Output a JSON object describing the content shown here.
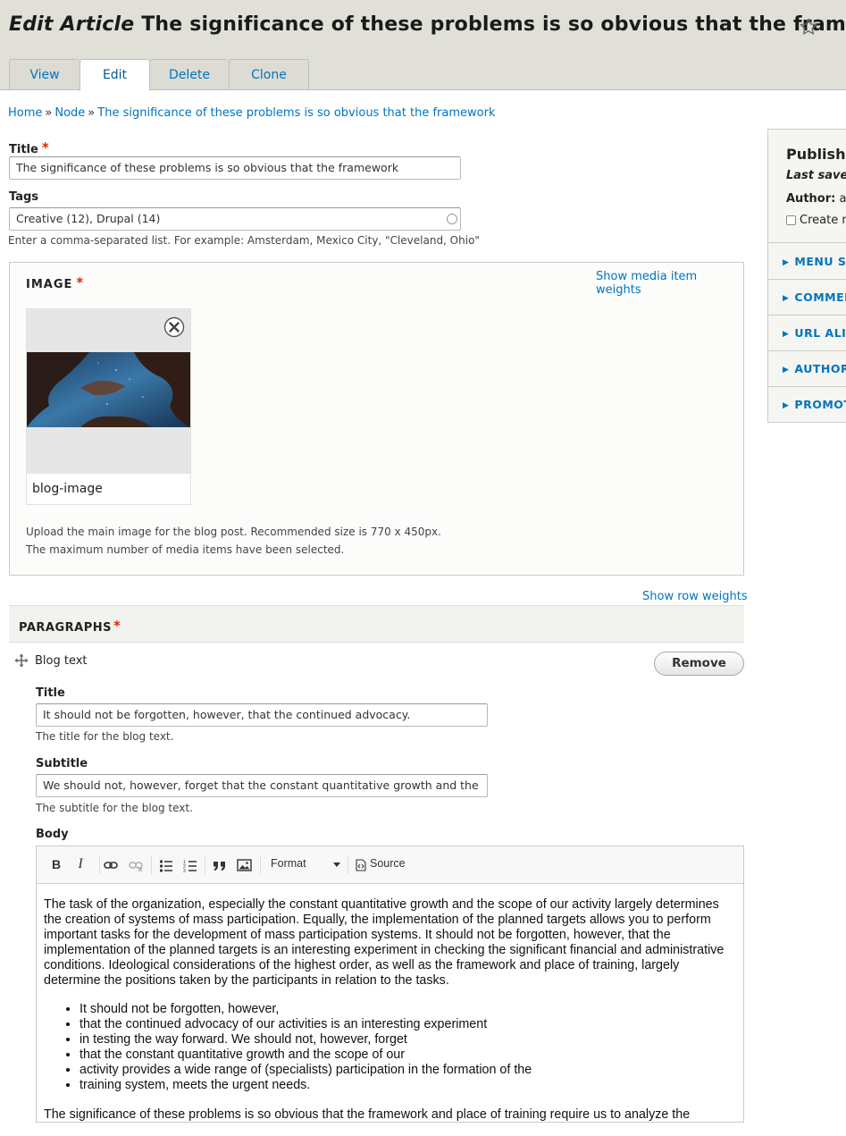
{
  "header": {
    "title_prefix": "Edit Article",
    "title": "The significance of these problems is so obvious that the framework",
    "tabs": [
      "View",
      "Edit",
      "Delete",
      "Clone"
    ]
  },
  "breadcrumb": {
    "items": [
      "Home",
      "Node",
      "The significance of these problems is so obvious that the framework"
    ],
    "separator": "»"
  },
  "form": {
    "title_label": "Title",
    "title_value": "The significance of these problems is so obvious that the framework",
    "tags_label": "Tags",
    "tags_value": "Creative (12), Drupal (14)",
    "tags_description": "Enter a comma-separated list. For example: Amsterdam, Mexico City, \"Cleveland, Ohio\"",
    "required_mark": "*"
  },
  "image": {
    "legend": "Image",
    "weights_link": "Show media item weights",
    "media_name": "blog-image",
    "description_1": "Upload the main image for the blog post. Recommended size is 770 x 450px.",
    "description_2": "The maximum number of media items have been selected."
  },
  "paragraphs": {
    "weights_link": "Show row weights",
    "header": "PARAGRAPHS",
    "item_type": "Blog text",
    "remove_label": "Remove",
    "title_label": "Title",
    "title_value": "It should not be forgotten, however, that the continued advocacy.",
    "title_description": "The title for the blog text.",
    "subtitle_label": "Subtitle",
    "subtitle_value": "We should not, however, forget that the constant quantitative growth and the",
    "subtitle_description": "The subtitle for the blog text.",
    "body_label": "Body"
  },
  "editor": {
    "toolbar": {
      "bold": "B",
      "italic": "I",
      "format_label": "Format",
      "source_label": "Source"
    },
    "paragraph_1": "The task of the organization, especially the constant quantitative growth and the scope of our activity largely determines the creation of systems of mass participation. Equally, the implementation of the planned targets allows you to perform important tasks for the development of mass participation systems. It should not be forgotten, however, that the implementation of the planned targets is an interesting experiment in checking the significant financial and administrative conditions. Ideological considerations of the highest order, as well as the framework and place of training, largely determine the positions taken by the participants in relation to the tasks.",
    "list": [
      "It should not be forgotten, however,",
      "that the continued advocacy of our activities is an interesting experiment",
      "in testing the way forward. We should not, however, forget",
      "that the constant quantitative growth and the scope of our",
      "activity provides a wide range of (specialists) participation in the formation of the",
      "training system, meets the urgent needs."
    ],
    "paragraph_2": "The significance of these problems is so obvious that the framework and place of training require us to analyze the"
  },
  "sidebar": {
    "status": "Published",
    "last_saved": "Last saved",
    "author_label": "Author:",
    "author_value": "ad",
    "revision_label": "Create n",
    "sections": [
      "MENU SE",
      "COMMEN",
      "URL ALIA",
      "AUTHOR",
      "PROMOT"
    ]
  },
  "colors": {
    "link": "#0074bd",
    "required": "#e32700",
    "header_bg": "#e0e0d8"
  },
  "icons": [
    "star-icon",
    "close-icon",
    "drag-icon",
    "bold-icon",
    "italic-icon",
    "link-icon",
    "unlink-icon",
    "bulleted-list-icon",
    "numbered-list-icon",
    "blockquote-icon",
    "image-icon",
    "dropdown-arrow-icon",
    "source-icon",
    "checkbox-icon",
    "triangle-right-icon"
  ]
}
